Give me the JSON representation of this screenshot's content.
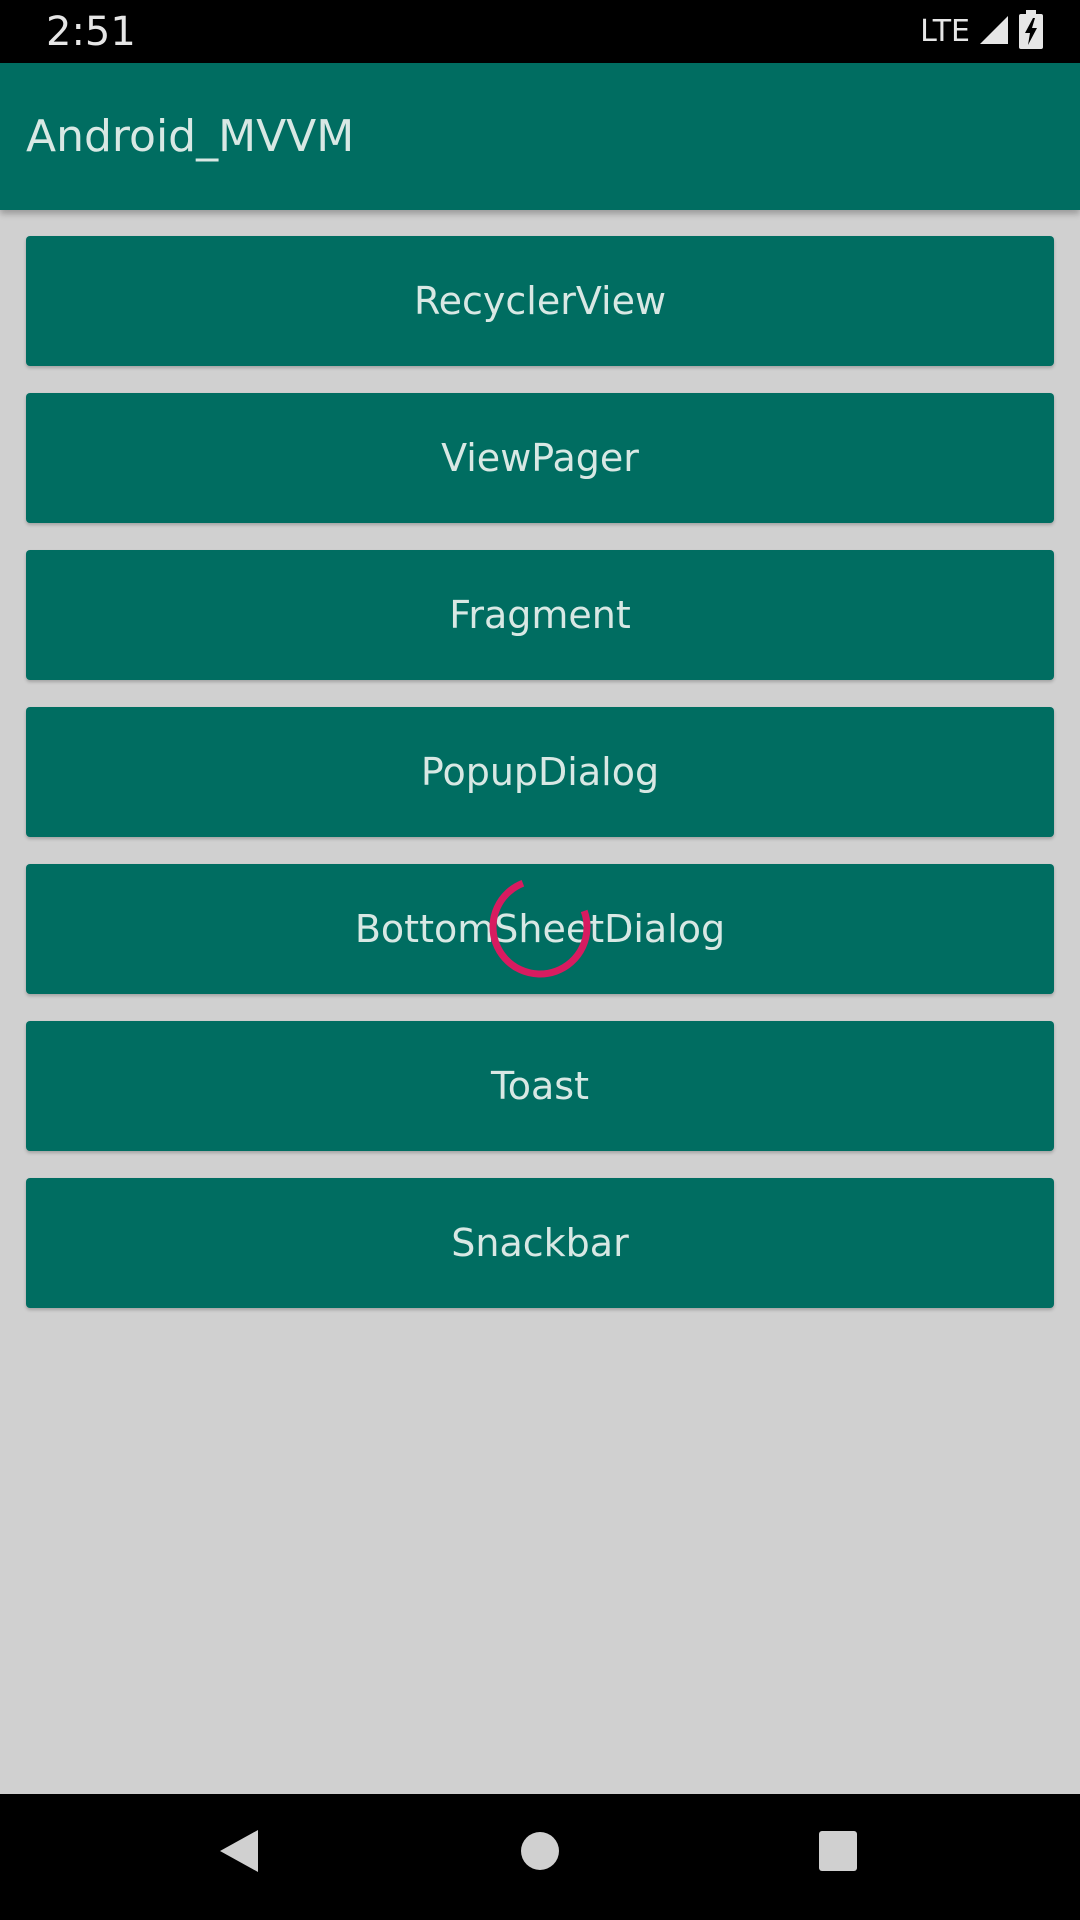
{
  "status_bar": {
    "time": "2:51",
    "network": "LTE",
    "icons": [
      "signal-icon",
      "battery-charging-icon"
    ]
  },
  "app_bar": {
    "title": "Android_MVVM"
  },
  "buttons": [
    {
      "label": "RecyclerView"
    },
    {
      "label": "ViewPager"
    },
    {
      "label": "Fragment"
    },
    {
      "label": "PopupDialog"
    },
    {
      "label": "BottomSheetDialog"
    },
    {
      "label": "Toast"
    },
    {
      "label": "Snackbar"
    }
  ],
  "loading_indicator": {
    "icon": "loading-spinner-icon",
    "color": "#d81b60"
  },
  "nav_bar": {
    "icons": [
      "back-icon",
      "home-icon",
      "recents-icon"
    ]
  },
  "colors": {
    "primary": "#006d61",
    "background": "#d0d0d0",
    "accent": "#d81b60"
  }
}
